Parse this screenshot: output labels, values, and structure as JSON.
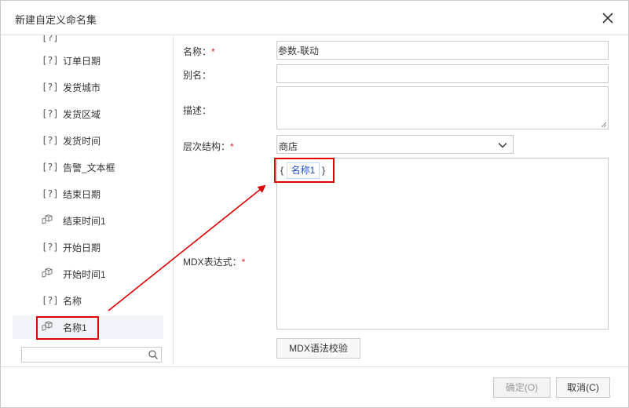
{
  "dialog": {
    "title": "新建自定义命名集"
  },
  "tree": {
    "items": [
      {
        "icon": "[?]",
        "label": "订单日期",
        "type": "param"
      },
      {
        "icon": "[?]",
        "label": "发货城市",
        "type": "param"
      },
      {
        "icon": "[?]",
        "label": "发货区域",
        "type": "param"
      },
      {
        "icon": "[?]",
        "label": "发货时间",
        "type": "param"
      },
      {
        "icon": "[?]",
        "label": "告警_文本框",
        "type": "param"
      },
      {
        "icon": "[?]",
        "label": "结束日期",
        "type": "param"
      },
      {
        "icon": "cube",
        "label": "结束时间1",
        "type": "cube"
      },
      {
        "icon": "[?]",
        "label": "开始日期",
        "type": "param"
      },
      {
        "icon": "cube",
        "label": "开始时间1",
        "type": "cube"
      },
      {
        "icon": "[?]",
        "label": "名称",
        "type": "param"
      },
      {
        "icon": "cube",
        "label": "名称1",
        "type": "cube",
        "selected": true
      }
    ],
    "search_placeholder": ""
  },
  "form": {
    "name_label": "名称：",
    "name_value": "参数-联动",
    "alias_label": "别名：",
    "alias_value": "",
    "desc_label": "描述：",
    "desc_value": "",
    "hierarchy_label": "层次结构：",
    "hierarchy_value": "商店",
    "mdx_label": "MDX表达式：",
    "mdx_open_brace": "{",
    "mdx_token": "名称1",
    "mdx_close_brace": "}",
    "required_mark": "*",
    "validate_button": "MDX语法校验"
  },
  "footer": {
    "ok_button": "确定(O)",
    "cancel_button": "取消(C)"
  },
  "colors": {
    "annotation_red": "#e00000",
    "token_blue": "#1e4fc9",
    "required_red": "#e02020"
  }
}
